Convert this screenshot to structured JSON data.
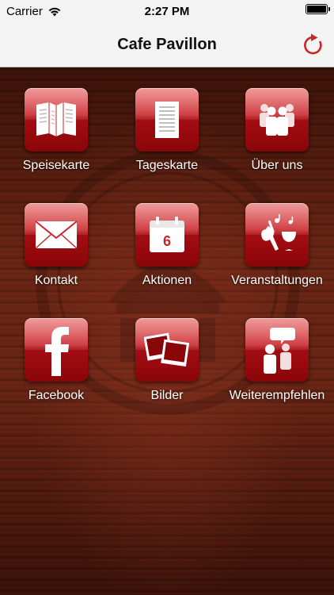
{
  "status_bar": {
    "carrier": "Carrier",
    "time": "2:27 PM"
  },
  "nav": {
    "title": "Cafe Pavillon",
    "refresh_icon": "refresh-icon"
  },
  "menu": [
    {
      "label": "Speisekarte",
      "icon": "menu-book-icon"
    },
    {
      "label": "Tageskarte",
      "icon": "daily-menu-icon"
    },
    {
      "label": "Über uns",
      "icon": "team-icon"
    },
    {
      "label": "Kontakt",
      "icon": "envelope-icon"
    },
    {
      "label": "Aktionen",
      "icon": "calendar-icon"
    },
    {
      "label": "Veranstaltungen",
      "icon": "events-icon"
    },
    {
      "label": "Facebook",
      "icon": "facebook-icon"
    },
    {
      "label": "Bilder",
      "icon": "photos-icon"
    },
    {
      "label": "Weiterempfehlen",
      "icon": "recommend-icon"
    }
  ],
  "calendar_day": "6",
  "colors": {
    "accent": "#c8252a",
    "nav_bg": "#f3f3f3",
    "refresh": "#c9262b"
  }
}
